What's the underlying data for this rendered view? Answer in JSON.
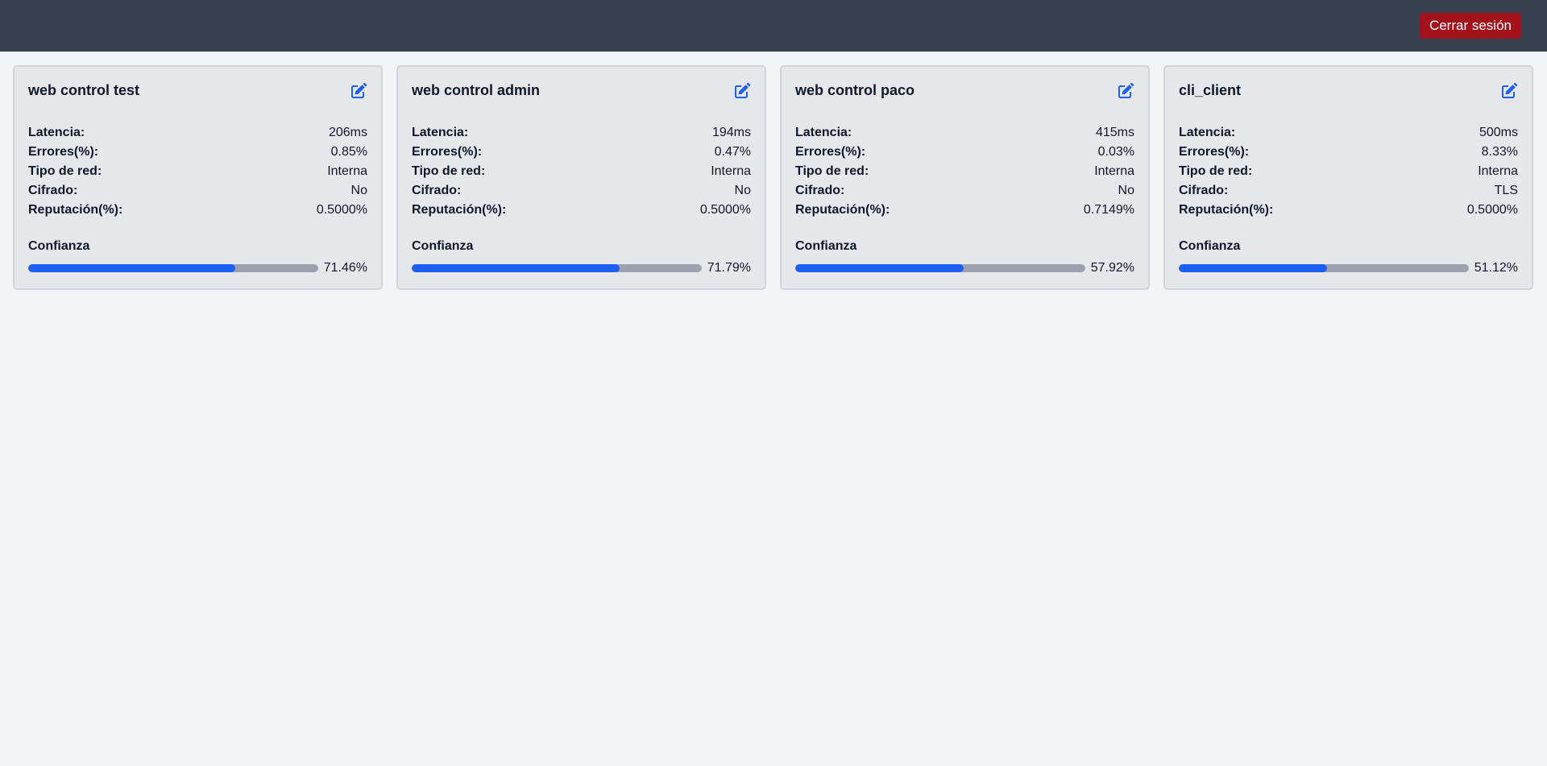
{
  "header": {
    "logout_label": "Cerrar sesión",
    "logout_color": "#a3111a",
    "background_color": "#374151"
  },
  "labels": {
    "latency": "Latencia:",
    "errors": "Errores(%):",
    "network": "Tipo de red:",
    "encryption": "Cifrado:",
    "reputation": "Reputación(%):",
    "trust": "Confianza"
  },
  "icons": {
    "edit": "edit-icon"
  },
  "accent_color": "#1d5ef5",
  "cards": [
    {
      "title": "web control test",
      "latency": "206ms",
      "errors": "0.85%",
      "network": "Interna",
      "encryption": "No",
      "reputation": "0.5000%",
      "trust": "71.46%",
      "trust_value": 71.46
    },
    {
      "title": "web control admin",
      "latency": "194ms",
      "errors": "0.47%",
      "network": "Interna",
      "encryption": "No",
      "reputation": "0.5000%",
      "trust": "71.79%",
      "trust_value": 71.79
    },
    {
      "title": "web control paco",
      "latency": "415ms",
      "errors": "0.03%",
      "network": "Interna",
      "encryption": "No",
      "reputation": "0.7149%",
      "trust": "57.92%",
      "trust_value": 57.92
    },
    {
      "title": "cli_client",
      "latency": "500ms",
      "errors": "8.33%",
      "network": "Interna",
      "encryption": "TLS",
      "reputation": "0.5000%",
      "trust": "51.12%",
      "trust_value": 51.12
    }
  ]
}
